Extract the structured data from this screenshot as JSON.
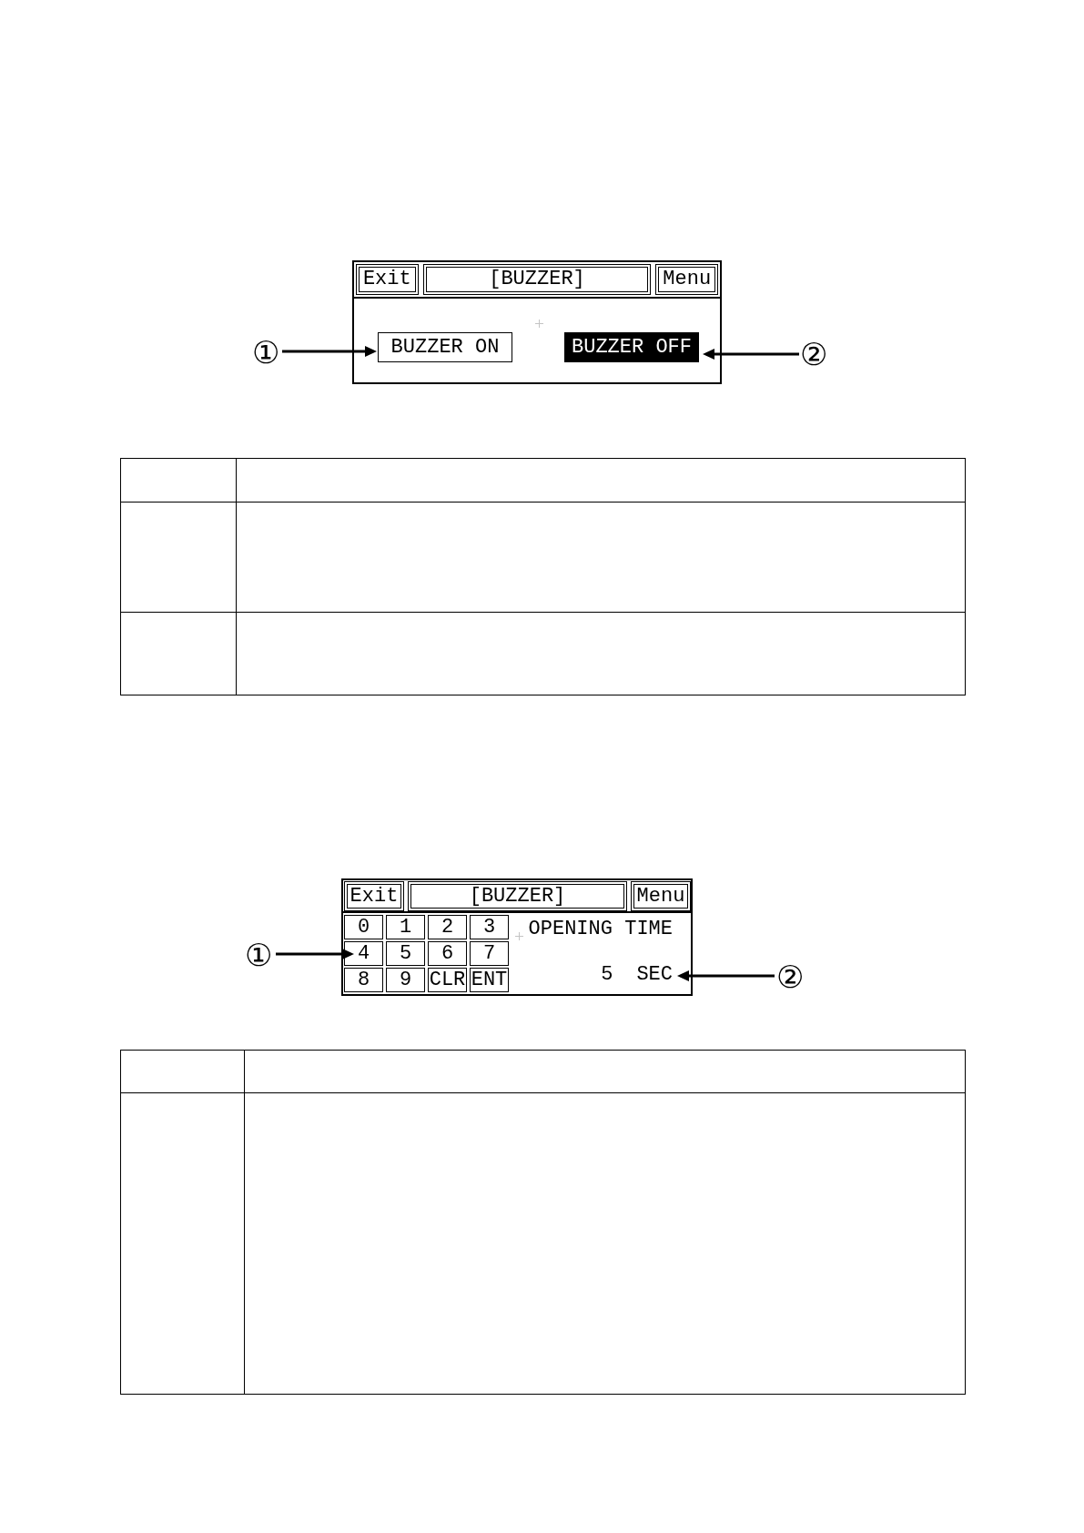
{
  "figure_1": {
    "screen": {
      "exit": "Exit",
      "title": "[BUZZER]",
      "menu": "Menu",
      "options": [
        {
          "label": "BUZZER ON",
          "selected": false
        },
        {
          "label": "BUZZER OFF",
          "selected": true
        }
      ]
    },
    "callouts": [
      "①",
      "②"
    ]
  },
  "figure_2": {
    "screen": {
      "exit": "Exit",
      "title": "[BUZZER]",
      "menu": "Menu",
      "keys": [
        "0",
        "1",
        "2",
        "3",
        "4",
        "5",
        "6",
        "7",
        "8",
        "9",
        "CLR",
        "ENT"
      ],
      "setting": {
        "label": "OPENING TIME",
        "value": "5",
        "unit": "SEC"
      }
    },
    "callouts": [
      "①",
      "②"
    ]
  }
}
